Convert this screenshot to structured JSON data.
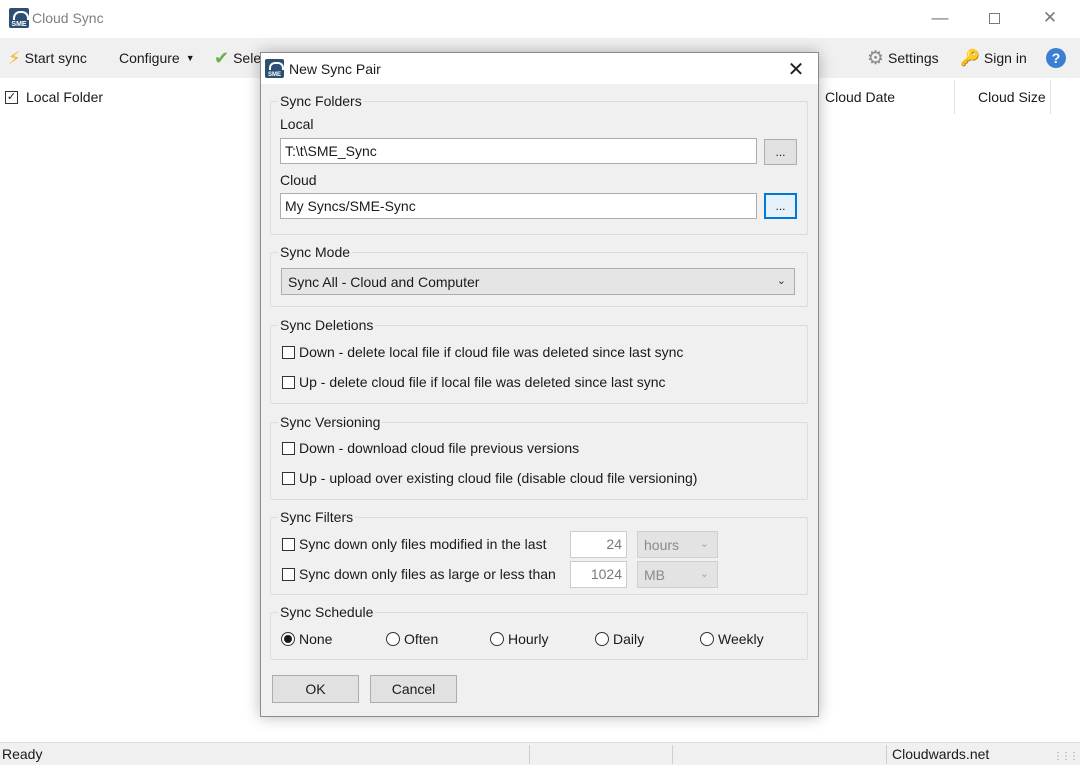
{
  "window": {
    "title": "Cloud Sync",
    "icon_label": "SME",
    "controls": [
      "minimize-icon",
      "maximize-icon",
      "close-icon"
    ]
  },
  "toolbar": {
    "start_sync": "Start sync",
    "configure": "Configure",
    "select": "Sele",
    "settings": "Settings",
    "sign_in": "Sign in"
  },
  "list_header": {
    "local_folder": "Local Folder",
    "cloud_date": "Cloud Date",
    "cloud_size": "Cloud Size",
    "select_all_checked": true
  },
  "status_bar": {
    "status": "Ready",
    "site": "Cloudwards.net"
  },
  "dialog": {
    "title": "New Sync Pair",
    "icon_label": "SME",
    "sync_folders": {
      "legend": "Sync Folders",
      "local_label": "Local",
      "local_value": "T:\\t\\SME_Sync",
      "cloud_label": "Cloud",
      "cloud_value": "My Syncs/SME-Sync",
      "browse_label": "..."
    },
    "sync_mode": {
      "legend": "Sync Mode",
      "selected": "Sync All - Cloud and Computer"
    },
    "sync_deletions": {
      "legend": "Sync Deletions",
      "down": "Down - delete local file if cloud file was deleted since last sync",
      "up": "Up - delete cloud file if local file was deleted since last sync"
    },
    "sync_versioning": {
      "legend": "Sync Versioning",
      "down": "Down - download cloud file previous versions",
      "up": "Up - upload over existing cloud file (disable cloud file versioning)"
    },
    "sync_filters": {
      "legend": "Sync Filters",
      "modified_label": "Sync down only files modified in the last",
      "modified_value": "24",
      "modified_unit": "hours",
      "size_label": "Sync down only files as large or less than",
      "size_value": "1024",
      "size_unit": "MB"
    },
    "sync_schedule": {
      "legend": "Sync Schedule",
      "options": [
        "None",
        "Often",
        "Hourly",
        "Daily",
        "Weekly"
      ],
      "selected": "None"
    },
    "ok_label": "OK",
    "cancel_label": "Cancel"
  }
}
